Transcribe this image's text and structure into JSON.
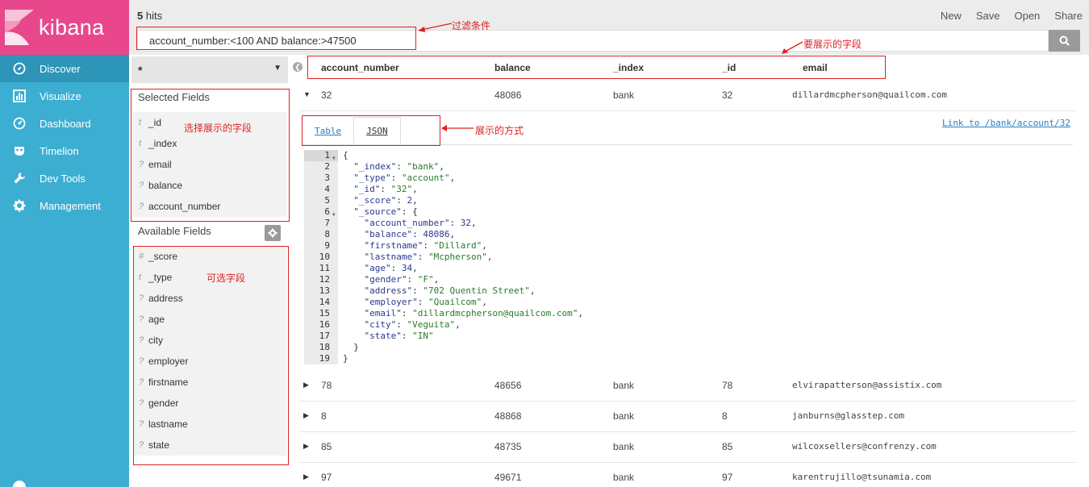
{
  "app": {
    "brand": "kibana"
  },
  "nav": [
    {
      "label": "Discover",
      "icon": "compass-icon",
      "active": true
    },
    {
      "label": "Visualize",
      "icon": "bar-chart-icon"
    },
    {
      "label": "Dashboard",
      "icon": "dashboard-icon"
    },
    {
      "label": "Timelion",
      "icon": "timelion-mask-icon"
    },
    {
      "label": "Dev Tools",
      "icon": "wrench-icon"
    },
    {
      "label": "Management",
      "icon": "gear-icon"
    }
  ],
  "topbar": {
    "hits_count": "5",
    "hits_label": " hits",
    "actions": [
      "New",
      "Save",
      "Open",
      "Share"
    ],
    "query": "account_number:<100 AND balance:>47500"
  },
  "fields": {
    "index_pattern": "*",
    "selected_title": "Selected Fields",
    "selected": [
      {
        "type": "t",
        "name": "_id"
      },
      {
        "type": "t",
        "name": "_index"
      },
      {
        "type": "?",
        "name": "email"
      },
      {
        "type": "?",
        "name": "balance"
      },
      {
        "type": "?",
        "name": "account_number"
      }
    ],
    "available_title": "Available Fields",
    "available": [
      {
        "type": "#",
        "name": "_score"
      },
      {
        "type": "t",
        "name": "_type"
      },
      {
        "type": "?",
        "name": "address"
      },
      {
        "type": "?",
        "name": "age"
      },
      {
        "type": "?",
        "name": "city"
      },
      {
        "type": "?",
        "name": "employer"
      },
      {
        "type": "?",
        "name": "firstname"
      },
      {
        "type": "?",
        "name": "gender"
      },
      {
        "type": "?",
        "name": "lastname"
      },
      {
        "type": "?",
        "name": "state"
      }
    ]
  },
  "table": {
    "columns": [
      "account_number",
      "balance",
      "_index",
      "_id",
      "email"
    ],
    "rows": [
      [
        "32",
        "48086",
        "bank",
        "32",
        "dillardmcpherson@quailcom.com"
      ],
      [
        "78",
        "48656",
        "bank",
        "78",
        "elvirapatterson@assistix.com"
      ],
      [
        "8",
        "48868",
        "bank",
        "8",
        "janburns@glasstep.com"
      ],
      [
        "85",
        "48735",
        "bank",
        "85",
        "wilcoxsellers@confrenzy.com"
      ],
      [
        "97",
        "49671",
        "bank",
        "97",
        "karentrujillo@tsunamia.com"
      ]
    ]
  },
  "detail": {
    "tabs": [
      "Table",
      "JSON"
    ],
    "link": "Link to /bank/account/32",
    "json_lines": [
      "{",
      "  \"_index\": \"bank\",",
      "  \"_type\": \"account\",",
      "  \"_id\": \"32\",",
      "  \"_score\": 2,",
      "  \"_source\": {",
      "    \"account_number\": 32,",
      "    \"balance\": 48086,",
      "    \"firstname\": \"Dillard\",",
      "    \"lastname\": \"Mcpherson\",",
      "    \"age\": 34,",
      "    \"gender\": \"F\",",
      "    \"address\": \"702 Quentin Street\",",
      "    \"employer\": \"Quailcom\",",
      "    \"email\": \"dillardmcpherson@quailcom.com\",",
      "    \"city\": \"Veguita\",",
      "    \"state\": \"IN\"",
      "  }",
      "}"
    ]
  },
  "annotations": {
    "filter": "过滤条件",
    "columns": "要展示的字段",
    "selected": "选择展示的字段",
    "view_mode": "展示的方式",
    "available": "可选字段"
  },
  "colors": {
    "sidebar": "#3caed2",
    "logo": "#e8488b",
    "annotation": "#e02020"
  }
}
